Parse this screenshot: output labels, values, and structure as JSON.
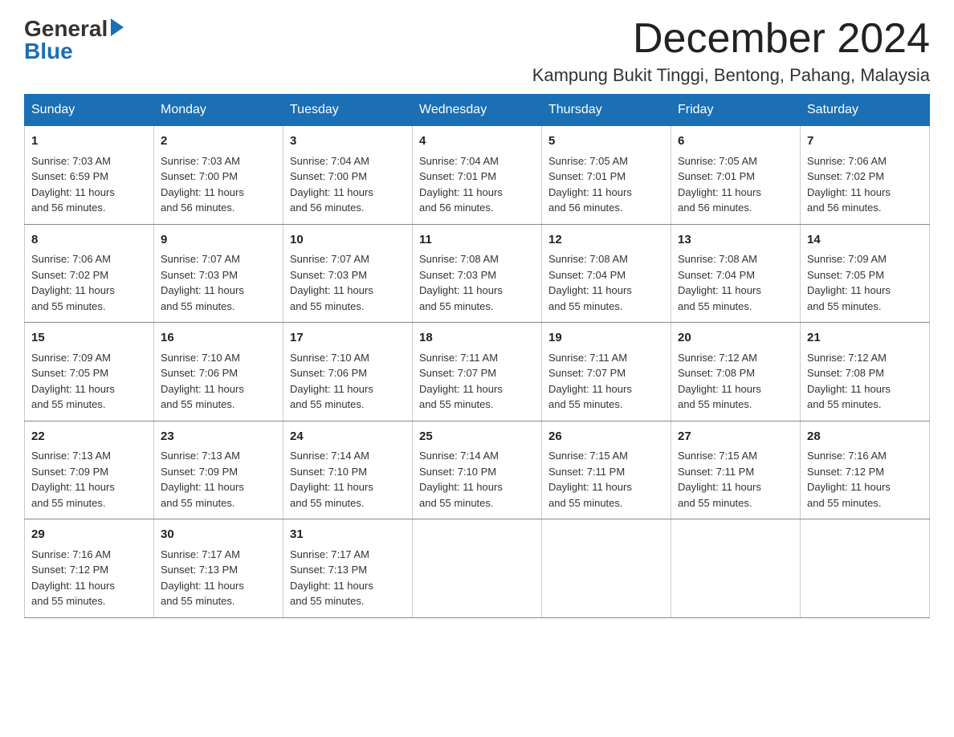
{
  "header": {
    "logo_general": "General",
    "logo_blue": "Blue",
    "month_title": "December 2024",
    "location": "Kampung Bukit Tinggi, Bentong, Pahang, Malaysia"
  },
  "days_of_week": [
    "Sunday",
    "Monday",
    "Tuesday",
    "Wednesday",
    "Thursday",
    "Friday",
    "Saturday"
  ],
  "weeks": [
    [
      {
        "day": "1",
        "sunrise": "7:03 AM",
        "sunset": "6:59 PM",
        "daylight": "11 hours and 56 minutes."
      },
      {
        "day": "2",
        "sunrise": "7:03 AM",
        "sunset": "7:00 PM",
        "daylight": "11 hours and 56 minutes."
      },
      {
        "day": "3",
        "sunrise": "7:04 AM",
        "sunset": "7:00 PM",
        "daylight": "11 hours and 56 minutes."
      },
      {
        "day": "4",
        "sunrise": "7:04 AM",
        "sunset": "7:01 PM",
        "daylight": "11 hours and 56 minutes."
      },
      {
        "day": "5",
        "sunrise": "7:05 AM",
        "sunset": "7:01 PM",
        "daylight": "11 hours and 56 minutes."
      },
      {
        "day": "6",
        "sunrise": "7:05 AM",
        "sunset": "7:01 PM",
        "daylight": "11 hours and 56 minutes."
      },
      {
        "day": "7",
        "sunrise": "7:06 AM",
        "sunset": "7:02 PM",
        "daylight": "11 hours and 56 minutes."
      }
    ],
    [
      {
        "day": "8",
        "sunrise": "7:06 AM",
        "sunset": "7:02 PM",
        "daylight": "11 hours and 55 minutes."
      },
      {
        "day": "9",
        "sunrise": "7:07 AM",
        "sunset": "7:03 PM",
        "daylight": "11 hours and 55 minutes."
      },
      {
        "day": "10",
        "sunrise": "7:07 AM",
        "sunset": "7:03 PM",
        "daylight": "11 hours and 55 minutes."
      },
      {
        "day": "11",
        "sunrise": "7:08 AM",
        "sunset": "7:03 PM",
        "daylight": "11 hours and 55 minutes."
      },
      {
        "day": "12",
        "sunrise": "7:08 AM",
        "sunset": "7:04 PM",
        "daylight": "11 hours and 55 minutes."
      },
      {
        "day": "13",
        "sunrise": "7:08 AM",
        "sunset": "7:04 PM",
        "daylight": "11 hours and 55 minutes."
      },
      {
        "day": "14",
        "sunrise": "7:09 AM",
        "sunset": "7:05 PM",
        "daylight": "11 hours and 55 minutes."
      }
    ],
    [
      {
        "day": "15",
        "sunrise": "7:09 AM",
        "sunset": "7:05 PM",
        "daylight": "11 hours and 55 minutes."
      },
      {
        "day": "16",
        "sunrise": "7:10 AM",
        "sunset": "7:06 PM",
        "daylight": "11 hours and 55 minutes."
      },
      {
        "day": "17",
        "sunrise": "7:10 AM",
        "sunset": "7:06 PM",
        "daylight": "11 hours and 55 minutes."
      },
      {
        "day": "18",
        "sunrise": "7:11 AM",
        "sunset": "7:07 PM",
        "daylight": "11 hours and 55 minutes."
      },
      {
        "day": "19",
        "sunrise": "7:11 AM",
        "sunset": "7:07 PM",
        "daylight": "11 hours and 55 minutes."
      },
      {
        "day": "20",
        "sunrise": "7:12 AM",
        "sunset": "7:08 PM",
        "daylight": "11 hours and 55 minutes."
      },
      {
        "day": "21",
        "sunrise": "7:12 AM",
        "sunset": "7:08 PM",
        "daylight": "11 hours and 55 minutes."
      }
    ],
    [
      {
        "day": "22",
        "sunrise": "7:13 AM",
        "sunset": "7:09 PM",
        "daylight": "11 hours and 55 minutes."
      },
      {
        "day": "23",
        "sunrise": "7:13 AM",
        "sunset": "7:09 PM",
        "daylight": "11 hours and 55 minutes."
      },
      {
        "day": "24",
        "sunrise": "7:14 AM",
        "sunset": "7:10 PM",
        "daylight": "11 hours and 55 minutes."
      },
      {
        "day": "25",
        "sunrise": "7:14 AM",
        "sunset": "7:10 PM",
        "daylight": "11 hours and 55 minutes."
      },
      {
        "day": "26",
        "sunrise": "7:15 AM",
        "sunset": "7:11 PM",
        "daylight": "11 hours and 55 minutes."
      },
      {
        "day": "27",
        "sunrise": "7:15 AM",
        "sunset": "7:11 PM",
        "daylight": "11 hours and 55 minutes."
      },
      {
        "day": "28",
        "sunrise": "7:16 AM",
        "sunset": "7:12 PM",
        "daylight": "11 hours and 55 minutes."
      }
    ],
    [
      {
        "day": "29",
        "sunrise": "7:16 AM",
        "sunset": "7:12 PM",
        "daylight": "11 hours and 55 minutes."
      },
      {
        "day": "30",
        "sunrise": "7:17 AM",
        "sunset": "7:13 PM",
        "daylight": "11 hours and 55 minutes."
      },
      {
        "day": "31",
        "sunrise": "7:17 AM",
        "sunset": "7:13 PM",
        "daylight": "11 hours and 55 minutes."
      },
      null,
      null,
      null,
      null
    ]
  ],
  "labels": {
    "sunrise": "Sunrise:",
    "sunset": "Sunset:",
    "daylight": "Daylight:"
  }
}
